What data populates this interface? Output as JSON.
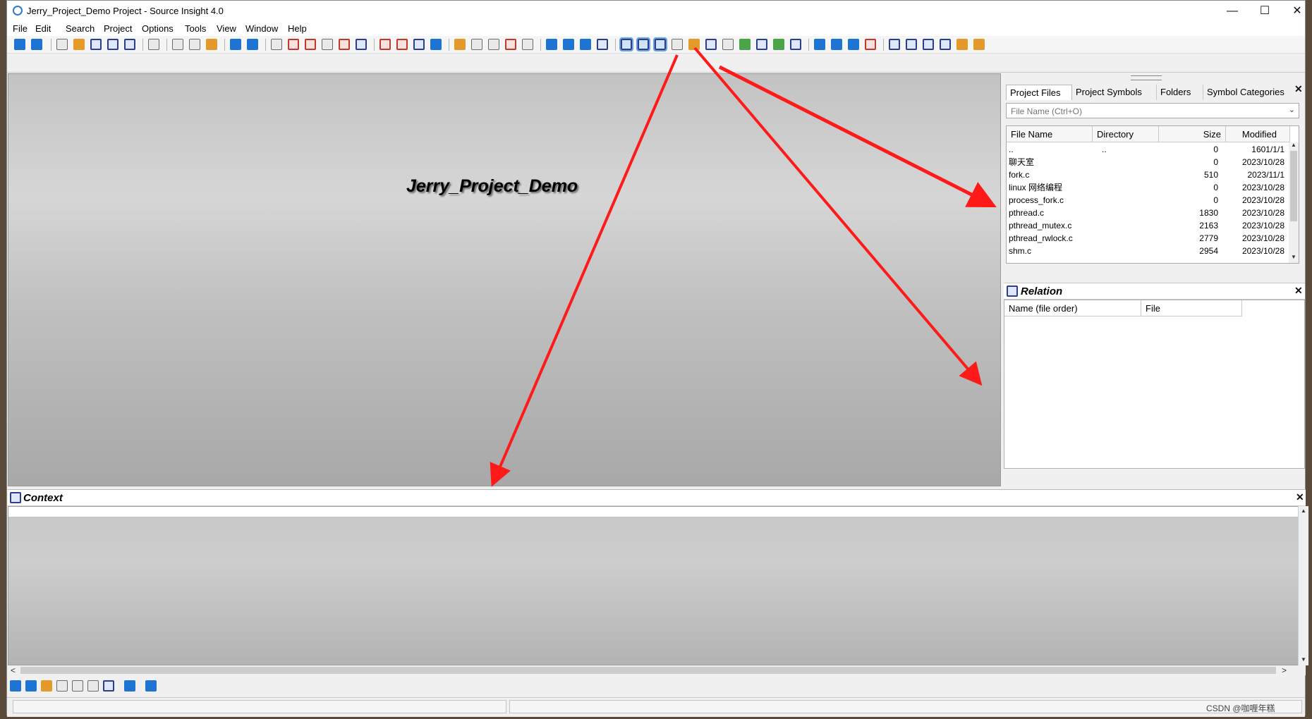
{
  "window": {
    "title": "Jerry_Project_Demo Project - Source Insight 4.0",
    "minimize": "—",
    "maximize": "☐",
    "close": "✕"
  },
  "menu": [
    "File",
    "Edit",
    "Search",
    "Project",
    "Options",
    "Tools",
    "View",
    "Window",
    "Help"
  ],
  "editor": {
    "project_title": "Jerry_Project_Demo"
  },
  "project_panel": {
    "tabs": [
      "Project Files",
      "Project Symbols",
      "Folders",
      "Symbol Categories"
    ],
    "tab_close": "×",
    "filter_placeholder": "File Name (Ctrl+O)",
    "columns": [
      "File Name",
      "Directory",
      "Size",
      "Modified"
    ],
    "rows": [
      {
        "name": "..",
        "dir": "..",
        "size": "0",
        "modified": "1601/1/1"
      },
      {
        "name": "聊天室",
        "dir": "",
        "size": "0",
        "modified": "2023/10/28"
      },
      {
        "name": "fork.c",
        "dir": "",
        "size": "510",
        "modified": "2023/11/1"
      },
      {
        "name": "linux 网络编程",
        "dir": "",
        "size": "0",
        "modified": "2023/10/28"
      },
      {
        "name": "process_fork.c",
        "dir": "",
        "size": "0",
        "modified": "2023/10/28"
      },
      {
        "name": "pthread.c",
        "dir": "",
        "size": "1830",
        "modified": "2023/10/28"
      },
      {
        "name": "pthread_mutex.c",
        "dir": "",
        "size": "2163",
        "modified": "2023/10/28"
      },
      {
        "name": "pthread_rwlock.c",
        "dir": "",
        "size": "2779",
        "modified": "2023/10/28"
      },
      {
        "name": "shm.c",
        "dir": "",
        "size": "2954",
        "modified": "2023/10/28"
      }
    ]
  },
  "relation_panel": {
    "title": "Relation",
    "columns": [
      "Name (file order)",
      "File"
    ]
  },
  "context_panel": {
    "title": "Context"
  },
  "status": {
    "right_text": "CSDN @咖喱年糕"
  },
  "icons": {
    "close": "✕",
    "scroll_up": "▲",
    "scroll_down": "▼",
    "scroll_left": "<",
    "scroll_right": ">",
    "dropdown": "⌄"
  },
  "colors": {
    "annotation_arrow": "#ff1a1a",
    "accent": "#1e74d2"
  }
}
